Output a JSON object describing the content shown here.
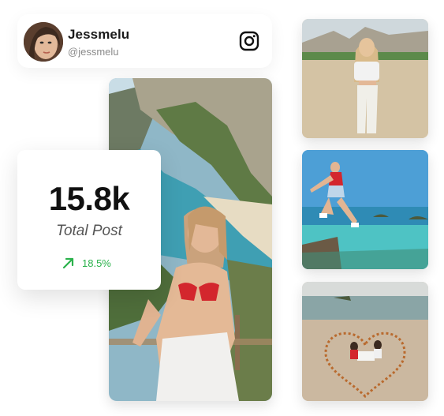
{
  "profile": {
    "name": "Jessmelu",
    "handle": "@jessmelu",
    "social_icon": "instagram-icon"
  },
  "stats": {
    "value": "15.8k",
    "label": "Total Post",
    "trend_value": "18.5%",
    "trend_icon": "arrow-up-right-icon",
    "trend_color": "#2bb24c"
  },
  "photos": {
    "main": "woman-red-bikini-cliff-photo",
    "thumbs": [
      "woman-white-outfit-beach-photo",
      "woman-leaping-ocean-photo",
      "heart-dinner-beach-photo"
    ]
  }
}
